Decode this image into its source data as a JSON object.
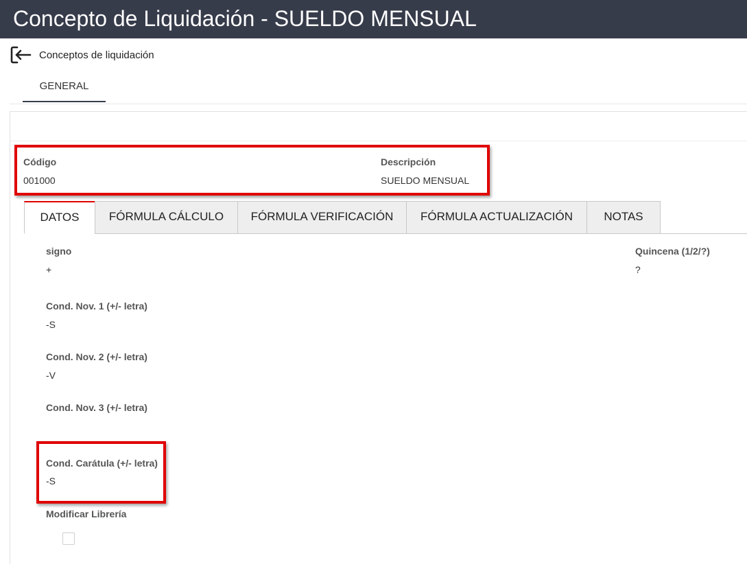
{
  "page": {
    "title": "Concepto de Liquidación - SUELDO MENSUAL",
    "back_label": "Conceptos de liquidación",
    "main_tab": "GENERAL"
  },
  "header_fields": {
    "codigo": {
      "label": "Código",
      "value": "001000"
    },
    "descripcion": {
      "label": "Descripción",
      "value": "SUELDO MENSUAL"
    }
  },
  "tabs": [
    {
      "label": "DATOS",
      "active": true
    },
    {
      "label": "FÓRMULA CÁLCULO",
      "active": false
    },
    {
      "label": "FÓRMULA VERIFICACIÓN",
      "active": false
    },
    {
      "label": "FÓRMULA ACTUALIZACIÓN",
      "active": false
    },
    {
      "label": "NOTAS",
      "active": false
    }
  ],
  "datos": {
    "signo": {
      "label": "signo",
      "value": "+"
    },
    "quincena": {
      "label": "Quincena (1/2/?)",
      "value": "?"
    },
    "cond_nov_1": {
      "label": "Cond. Nov. 1 (+/- letra)",
      "value": "-S"
    },
    "cond_nov_2": {
      "label": "Cond. Nov. 2 (+/- letra)",
      "value": "-V"
    },
    "cond_nov_3": {
      "label": "Cond. Nov. 3 (+/- letra)",
      "value": ""
    },
    "cond_caratula": {
      "label": "Cond. Carátula (+/- letra)",
      "value": "-S"
    },
    "modificar_libreria": {
      "label": "Modificar Librería",
      "checked": false
    }
  },
  "colors": {
    "titlebar": "#373c4b",
    "highlight": "#e00000"
  },
  "icons": {
    "back": "exit-arrow-icon"
  }
}
